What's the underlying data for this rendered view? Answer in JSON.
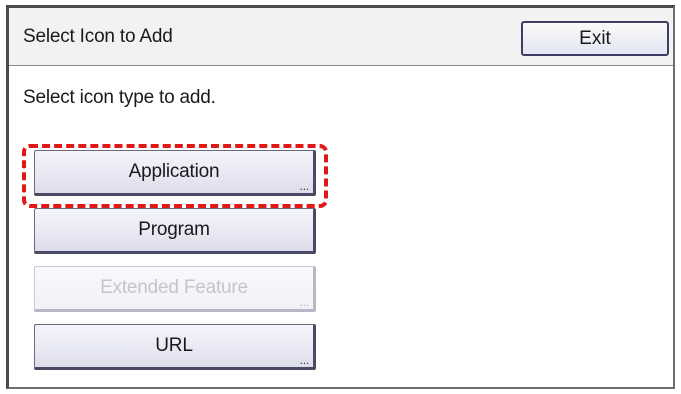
{
  "window": {
    "title": "Select Icon to Add",
    "exit_label": "Exit"
  },
  "instruction": "Select icon type to add.",
  "options": [
    {
      "label": "Application",
      "has_more": true,
      "more_glyph": "...",
      "enabled": true,
      "highlighted": true
    },
    {
      "label": "Program",
      "has_more": false,
      "more_glyph": "",
      "enabled": true,
      "highlighted": false
    },
    {
      "label": "Extended Feature",
      "has_more": true,
      "more_glyph": "...",
      "enabled": false,
      "highlighted": false
    },
    {
      "label": "URL",
      "has_more": true,
      "more_glyph": "...",
      "enabled": true,
      "highlighted": false
    }
  ],
  "colors": {
    "highlight": "#e01818",
    "disabled_text": "#c4c4cc"
  }
}
